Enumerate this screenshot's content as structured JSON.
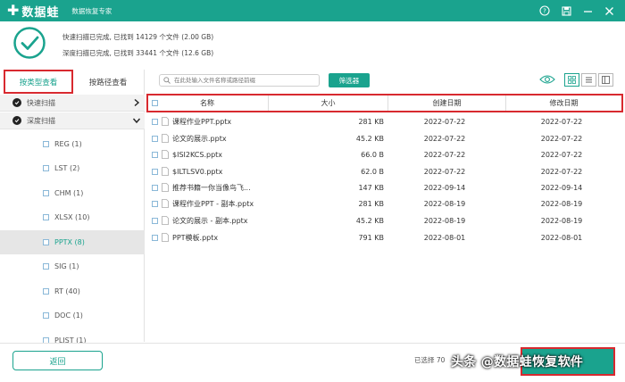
{
  "colors": {
    "brand": "#1aa38e",
    "highlight": "#d8292f",
    "selected_row": "#e6e6e6"
  },
  "titlebar": {
    "logo_icon": "plus-cross-icon",
    "app_name": "数据蛙",
    "app_subtitle": "数据恢复专家",
    "controls": [
      "help-icon",
      "save-icon",
      "minimize-icon",
      "close-icon"
    ]
  },
  "summary": {
    "quick_scan": "快速扫描已完成, 已找到 14129 个文件 (2.00 GB)",
    "deep_scan": "深度扫描已完成, 已找到 33441 个文件 (12.6 GB)"
  },
  "sidebar": {
    "tabs": {
      "by_type": "按类型查看",
      "by_path": "按路径查看"
    },
    "quick_scan_label": "快速扫描",
    "deep_scan_label": "深度扫描",
    "types": [
      {
        "label": "REG (1)"
      },
      {
        "label": "LST (2)"
      },
      {
        "label": "CHM (1)"
      },
      {
        "label": "XLSX (10)"
      },
      {
        "label": "PPTX (8)",
        "selected": true
      },
      {
        "label": "SIG (1)"
      },
      {
        "label": "RT (40)"
      },
      {
        "label": "DOC (1)"
      },
      {
        "label": "PLIST (1)"
      }
    ]
  },
  "toolbar": {
    "search_placeholder": "在此处输入文件名称或路径前缀",
    "filter_label": "筛选器",
    "view_modes": [
      "grid-view-icon",
      "list-view-icon",
      "detail-view-icon"
    ],
    "active_view": "grid-view-icon"
  },
  "table": {
    "columns": {
      "name": "名称",
      "size": "大小",
      "created": "创建日期",
      "modified": "修改日期"
    },
    "rows": [
      {
        "name": "课程作业PPT.pptx",
        "size": "281 KB",
        "created": "2022-07-22",
        "modified": "2022-07-22"
      },
      {
        "name": "论文的展示.pptx",
        "size": "45.2 KB",
        "created": "2022-07-22",
        "modified": "2022-07-22"
      },
      {
        "name": "$ISI2KCS.pptx",
        "size": "66.0  B",
        "created": "2022-07-22",
        "modified": "2022-07-22"
      },
      {
        "name": "$ILTLSV0.pptx",
        "size": "62.0  B",
        "created": "2022-07-22",
        "modified": "2022-07-22"
      },
      {
        "name": "推荐书籍一你当像鸟飞...",
        "size": "147 KB",
        "created": "2022-09-14",
        "modified": "2022-09-14"
      },
      {
        "name": "课程作业PPT - 副本.pptx",
        "size": "281 KB",
        "created": "2022-08-19",
        "modified": "2022-08-19"
      },
      {
        "name": "论文的展示 - 副本.pptx",
        "size": "45.2 KB",
        "created": "2022-08-19",
        "modified": "2022-08-19"
      },
      {
        "name": "PPT模板.pptx",
        "size": "791 KB",
        "created": "2022-08-01",
        "modified": "2022-08-01"
      }
    ]
  },
  "bottom": {
    "back_label": "返回",
    "selected_info": "已选择 70",
    "recover_label": "恢复",
    "watermark": "头条 @数据蛙恢复软件"
  }
}
